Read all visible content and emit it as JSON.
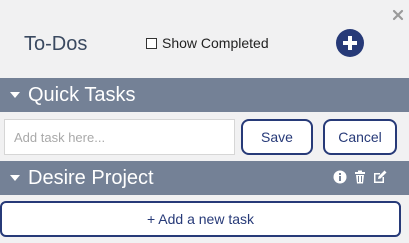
{
  "header": {
    "title": "To-Dos",
    "show_completed_label": "Show Completed",
    "show_completed_checked": false
  },
  "quick_tasks": {
    "title": "Quick Tasks",
    "input_placeholder": "Add task here...",
    "input_value": "",
    "save_label": "Save",
    "cancel_label": "Cancel"
  },
  "project": {
    "title": "Desire Project",
    "add_task_label": "+ Add a new task"
  },
  "icons": {
    "close": "close-icon",
    "add": "plus-circle-icon",
    "collapse": "caret-down-icon",
    "info": "info-icon",
    "delete": "trash-icon",
    "edit": "edit-icon"
  },
  "colors": {
    "panel_background": "#f1f1f2",
    "section_bar": "#748196",
    "accent": "#273a78",
    "title_text": "#3a4960"
  }
}
